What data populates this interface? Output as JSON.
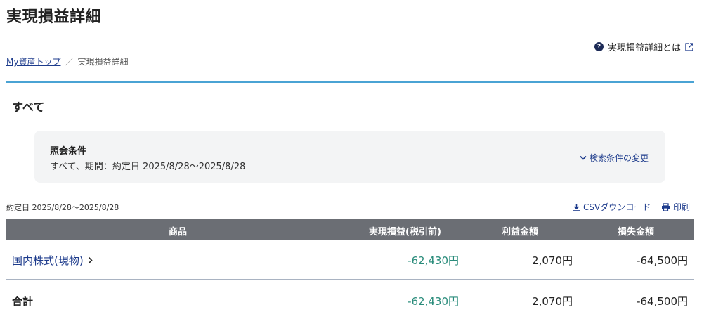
{
  "page": {
    "title": "実現損益詳細",
    "help_link": "実現損益詳細とは"
  },
  "breadcrumb": {
    "home": "My資産トップ",
    "separator": "／",
    "current": "実現損益詳細"
  },
  "section": {
    "title": "すべて"
  },
  "conditions": {
    "heading": "照会条件",
    "text": "すべて、期間：約定日 2025/8/28〜2025/8/28",
    "toggle": "検索条件の変更"
  },
  "toolbar": {
    "period": "約定日 2025/8/28〜2025/8/28",
    "csv": "CSVダウンロード",
    "print": "印刷"
  },
  "table": {
    "headers": {
      "product": "商品",
      "realized": "実現損益(税引前)",
      "profit": "利益金額",
      "loss": "損失金額"
    },
    "rows": [
      {
        "product": "国内株式(現物)",
        "realized": "-62,430円",
        "profit": "2,070円",
        "loss": "-64,500円"
      }
    ],
    "total": {
      "label": "合計",
      "realized": "-62,430円",
      "profit": "2,070円",
      "loss": "-64,500円"
    }
  },
  "colors": {
    "accent": "#4aa3d4",
    "link": "#1d3b8c",
    "gain": "#2a8c7b",
    "header_bg": "#6b6e74"
  }
}
